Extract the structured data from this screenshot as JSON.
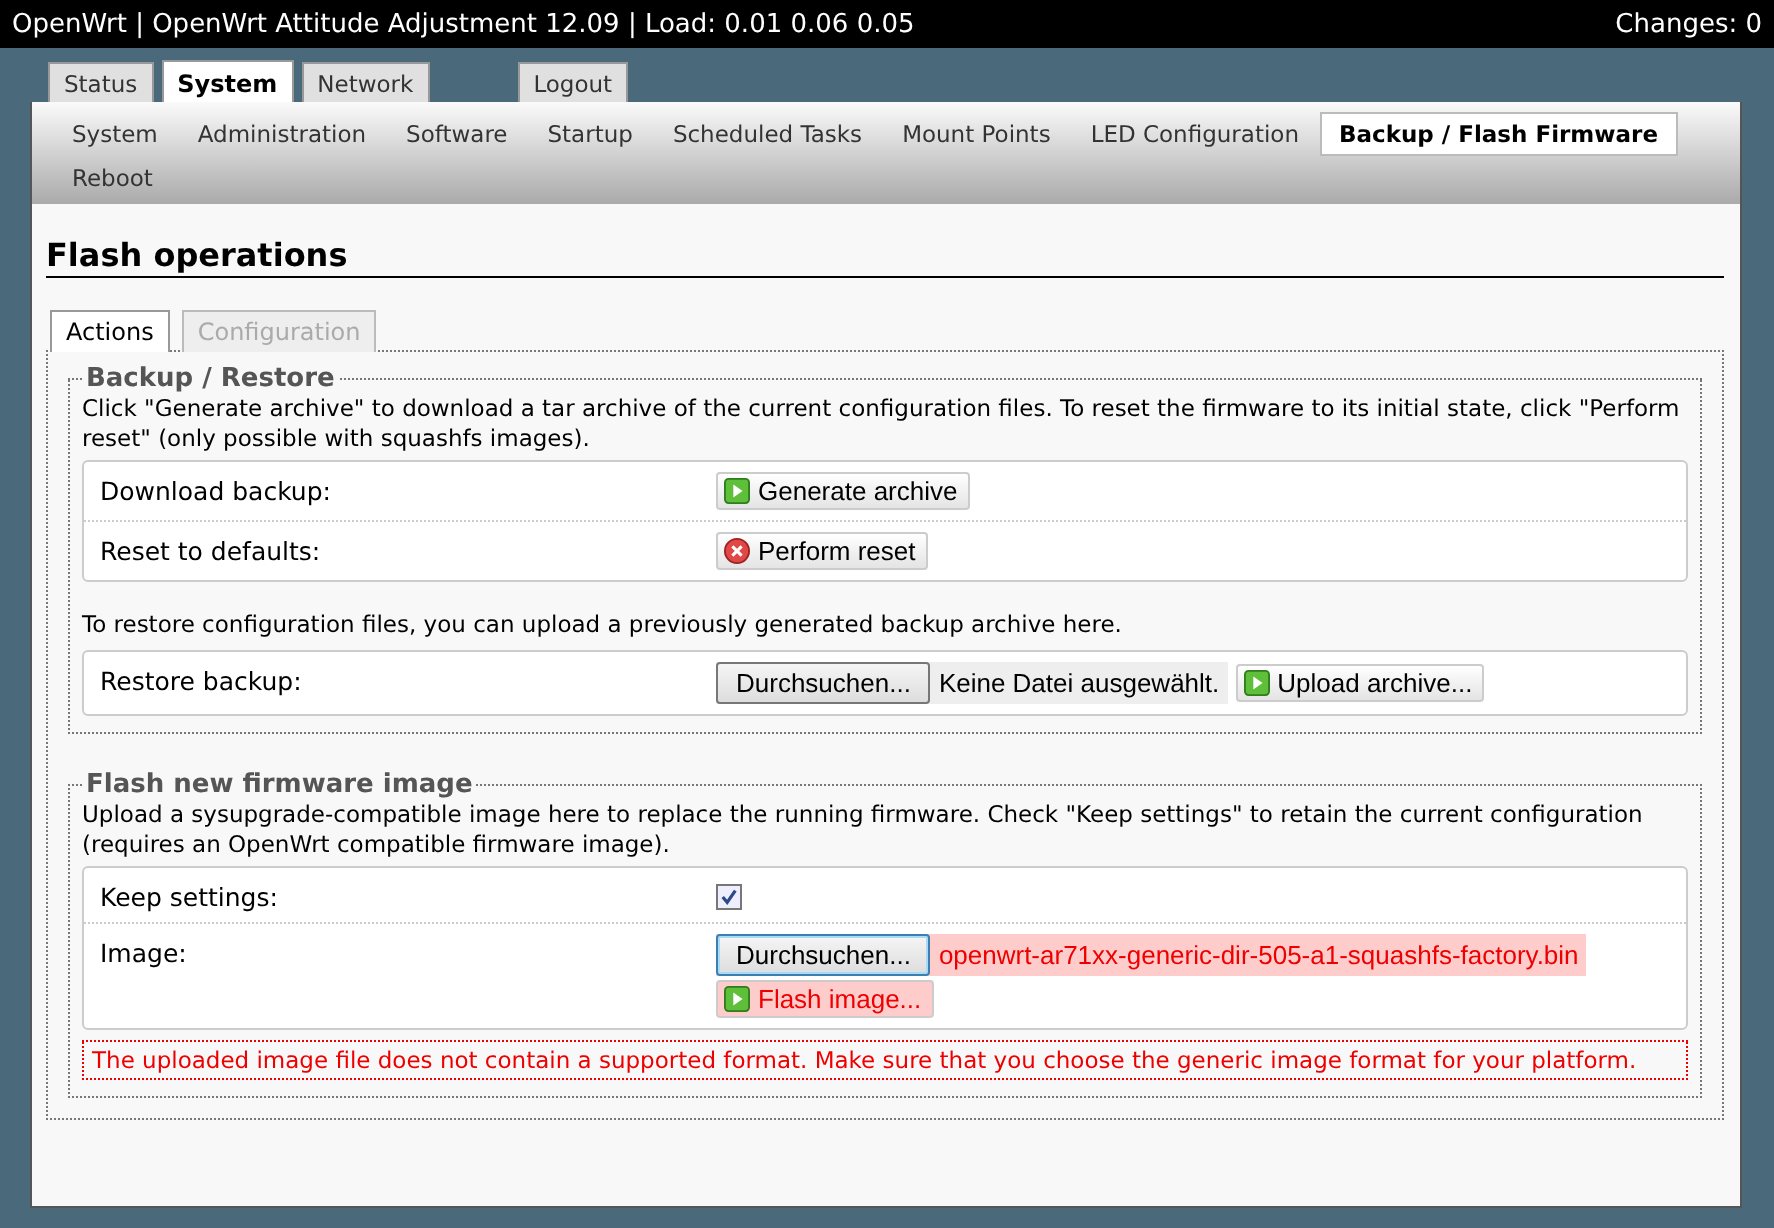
{
  "header": {
    "title": "OpenWrt | OpenWrt Attitude Adjustment 12.09 | Load: 0.01 0.06 0.05",
    "changes": "Changes: 0"
  },
  "main_tabs": [
    {
      "label": "Status",
      "selected": false
    },
    {
      "label": "System",
      "selected": true
    },
    {
      "label": "Network",
      "selected": false
    }
  ],
  "logout": "Logout",
  "sub_tabs": [
    {
      "label": "System",
      "selected": false
    },
    {
      "label": "Administration",
      "selected": false
    },
    {
      "label": "Software",
      "selected": false
    },
    {
      "label": "Startup",
      "selected": false
    },
    {
      "label": "Scheduled Tasks",
      "selected": false
    },
    {
      "label": "Mount Points",
      "selected": false
    },
    {
      "label": "LED Configuration",
      "selected": false
    },
    {
      "label": "Backup / Flash Firmware",
      "selected": true
    },
    {
      "label": "Reboot",
      "selected": false
    }
  ],
  "page_title": "Flash operations",
  "section_tabs": [
    {
      "label": "Actions",
      "selected": true
    },
    {
      "label": "Configuration",
      "selected": false
    }
  ],
  "backup": {
    "legend": "Backup / Restore",
    "description": "Click \"Generate archive\" to download a tar archive of the current configuration files. To reset the firmware to its initial state, click \"Perform reset\" (only possible with squashfs images).",
    "rows": [
      {
        "label": "Download backup:",
        "button": "Generate archive",
        "kind": "apply"
      },
      {
        "label": "Reset to defaults:",
        "button": "Perform reset",
        "kind": "reset"
      }
    ],
    "restore_note": "To restore configuration files, you can upload a previously generated backup archive here.",
    "restore": {
      "label": "Restore backup:",
      "browse": "Durchsuchen...",
      "file_status": "Keine Datei ausgewählt.",
      "upload": "Upload archive..."
    }
  },
  "flash": {
    "legend": "Flash new firmware image",
    "description": "Upload a sysupgrade-compatible image here to replace the running firmware. Check \"Keep settings\" to retain the current configuration (requires an OpenWrt compatible firmware image).",
    "keep": {
      "label": "Keep settings:",
      "checked": true
    },
    "image": {
      "label": "Image:",
      "browse": "Durchsuchen...",
      "file_name": "openwrt-ar71xx-generic-dir-505-a1-squashfs-factory.bin",
      "button": "Flash image...",
      "invalid": true
    },
    "error": "The uploaded image file does not contain a supported format. Make sure that you choose the generic image format for your platform."
  }
}
